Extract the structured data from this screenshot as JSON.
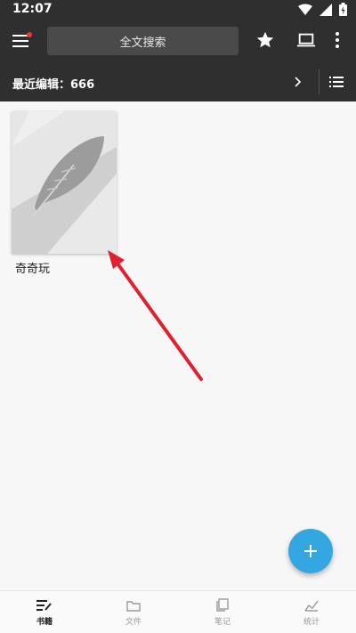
{
  "status_bar": {
    "time": "12:07"
  },
  "app_bar": {
    "search_placeholder": "全文搜索"
  },
  "recent": {
    "label": "最近编辑：666"
  },
  "books": [
    {
      "title": "奇奇玩"
    }
  ],
  "bottom_nav": {
    "items": [
      {
        "label": "书籍",
        "icon": "books-icon",
        "active": true
      },
      {
        "label": "文件",
        "icon": "folder-icon",
        "active": false
      },
      {
        "label": "笔记",
        "icon": "notes-icon",
        "active": false
      },
      {
        "label": "统计",
        "icon": "stats-icon",
        "active": false
      }
    ]
  },
  "colors": {
    "toolbar": "#2f2f2f",
    "fab": "#35a7e0",
    "arrow": "#e02030",
    "notification_dot": "#e53935"
  }
}
